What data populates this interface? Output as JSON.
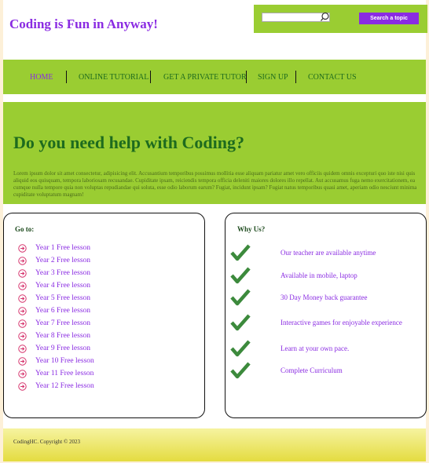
{
  "site": {
    "title": "Coding is Fun in Anyway!"
  },
  "search": {
    "placeholder": "",
    "button_label": "Search a topic"
  },
  "nav": {
    "items": [
      {
        "label": "HOME"
      },
      {
        "label": "ONLINE TUTORIAL"
      },
      {
        "label": "GET A PRIVATE TUTOR"
      },
      {
        "label": "SIGN UP"
      },
      {
        "label": "CONTACT US"
      }
    ]
  },
  "hero": {
    "title": "Do you need help with Coding?",
    "text": "Lorem ipsum dolor sit amet consectetur, adipisicing elit. Accusantium temporibus possimus mollitia esse aliquam pariatur amet vero officiis quidem omnis excepturi quo iste nisi quis aliquid eos quisquam, tempora laboriosam recusandae. Cupiditate ipsam, reiciendis tempora officia deleniti maiores dolores illo repellat. Aut accusamus fuga nemo exercitationem, ea cumque nulla tempore quia non voluptas repudiandae qui soluta, esse odio laborum earum? Fugiat, incidunt ipsam? Fugiat natus temporibus quasi amet, aperiam odio nesciunt minima cupiditate voluptatum magnam!"
  },
  "goto": {
    "heading": "Go to:",
    "items": [
      "Year 1 Free lesson",
      "Year 2 Free lesson",
      "Year 3 Free lesson",
      "Year 4 Free lesson",
      "Year 5 Free lesson",
      "Year 6 Free lesson",
      "Year 7 Free lesson",
      "Year 8 Free lesson",
      "Year 9 Free lesson",
      "Year 10 Free lesson",
      "Year 11 Free lesson",
      "Year 12 Free lesson"
    ]
  },
  "why": {
    "heading": "Why Us?",
    "items": [
      "Our teacher are available anytime",
      "Available in mobile, laptop",
      "30 Day Money back guarantee",
      "Interactive games for enjoyable experience",
      "Learn at your own pace.",
      "Complete Curriculum"
    ]
  },
  "footer": {
    "text": "CodingHC. Copyright © 2023"
  },
  "colors": {
    "accent_green": "#9acd32",
    "dark_green": "#1e6b1e",
    "purple": "#8a2be2",
    "icon_pink": "#d6336c",
    "check_green": "#3c8a3c"
  },
  "icons": {
    "lesson": "arrow-circle-right-icon",
    "why": "checkmark-icon",
    "search": "search-icon"
  }
}
